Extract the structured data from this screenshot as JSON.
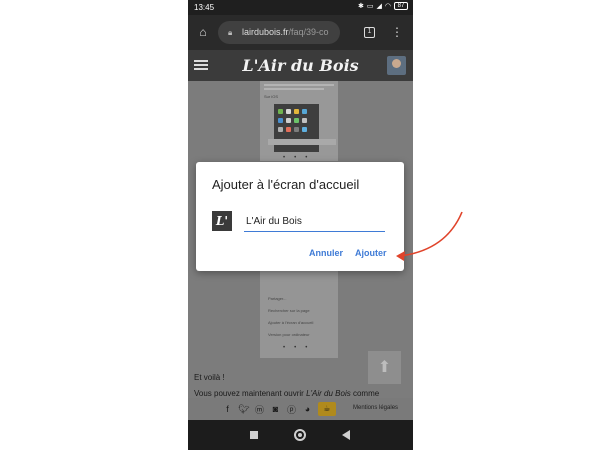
{
  "status_bar": {
    "time": "13:45",
    "battery": "87",
    "icons": [
      "bluetooth-icon",
      "vpn-icon",
      "signal-icon",
      "wifi-icon",
      "battery-icon"
    ]
  },
  "browser": {
    "url_domain": "lairdubois.fr",
    "url_path": "/faq/39-co",
    "tab_count": "1"
  },
  "site": {
    "logo": "L'Air du Bois"
  },
  "page": {
    "screenshot_label": "Sur iOS",
    "voila": "Et voilà !",
    "follow_before": "Vous pouvez maintenant ouvrir ",
    "follow_em": "L'Air du Bois",
    "follow_after": " comme",
    "legal_link": "Mentions légales",
    "footer_icons": [
      "facebook-icon",
      "twitter-icon",
      "mastodon-icon",
      "instagram-icon",
      "pinterest-icon",
      "github-icon",
      "coffee-icon"
    ],
    "menu_rows": [
      "Partager...",
      "Rechercher sur la page",
      "Ajouter à l'écran d'accueil",
      "Version pour ordinateur"
    ]
  },
  "dialog": {
    "title": "Ajouter à l'écran d'accueil",
    "app_icon_text": "L'",
    "name_value": "L'Air du Bois",
    "cancel_label": "Annuler",
    "add_label": "Ajouter"
  },
  "colors": {
    "accent": "#3f7bd6",
    "annotation_arrow": "#e0442b",
    "coffee": "#b08a1c"
  }
}
